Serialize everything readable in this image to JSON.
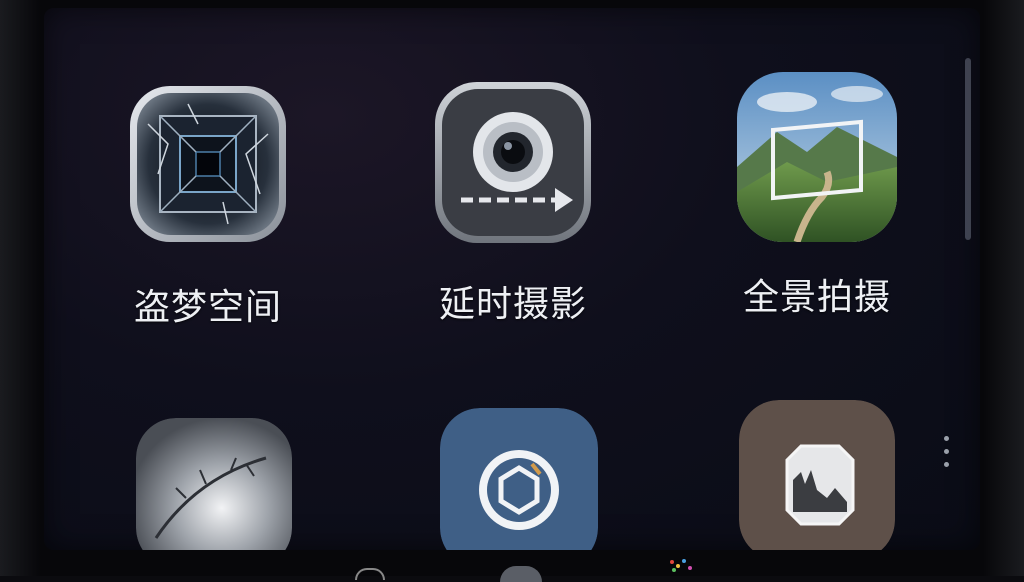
{
  "apps": [
    {
      "label": "盗梦空间",
      "icon": "inception-cube-icon"
    },
    {
      "label": "延时摄影",
      "icon": "timelapse-camera-icon"
    },
    {
      "label": "全景拍摄",
      "icon": "panorama-landscape-icon"
    },
    {
      "label": "",
      "icon": "cracked-glass-icon"
    },
    {
      "label": "",
      "icon": "hexagon-lens-icon"
    },
    {
      "label": "",
      "icon": "monochrome-photo-icon"
    }
  ],
  "colors": {
    "screen_bg": "#0f0f1c",
    "label_text": "#eef0f4",
    "tile_blue": "#3f5f86",
    "tile_brown": "#5e5049"
  }
}
